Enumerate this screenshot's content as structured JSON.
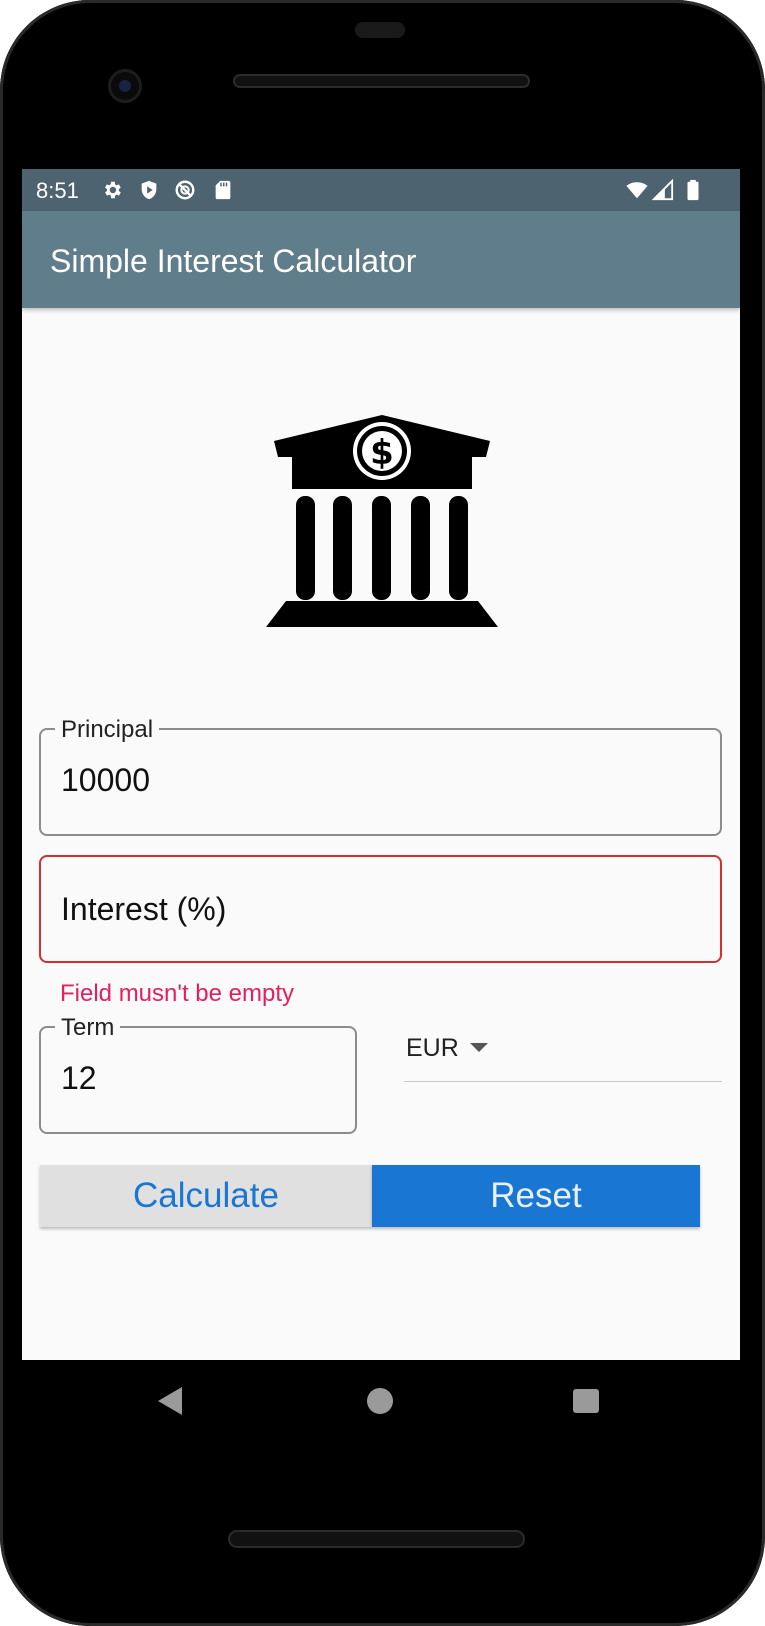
{
  "status_bar": {
    "time": "8:51",
    "left_icons": [
      "gear-icon",
      "shield-play-icon",
      "no-sync-icon",
      "sd-card-icon"
    ],
    "right_icons": [
      "wifi-icon",
      "cell-signal-icon",
      "battery-icon"
    ]
  },
  "app_bar": {
    "title": "Simple Interest Calculator"
  },
  "hero": {
    "icon": "bank-dollar-icon"
  },
  "form": {
    "principal": {
      "label": "Principal",
      "value": "10000"
    },
    "interest": {
      "label": "Interest (%)",
      "value": "",
      "error": "Field musn't be empty"
    },
    "term": {
      "label": "Term",
      "value": "12"
    },
    "currency": {
      "selected": "EUR"
    }
  },
  "buttons": {
    "calculate": "Calculate",
    "reset": "Reset"
  },
  "nav": {
    "icons": [
      "back-icon",
      "home-icon",
      "recents-icon"
    ]
  },
  "colors": {
    "status_bar": "#4d6470",
    "app_bar": "#607d8b",
    "primary": "#1976d2",
    "error": "#d32f2f",
    "error_text": "#e3205f"
  }
}
